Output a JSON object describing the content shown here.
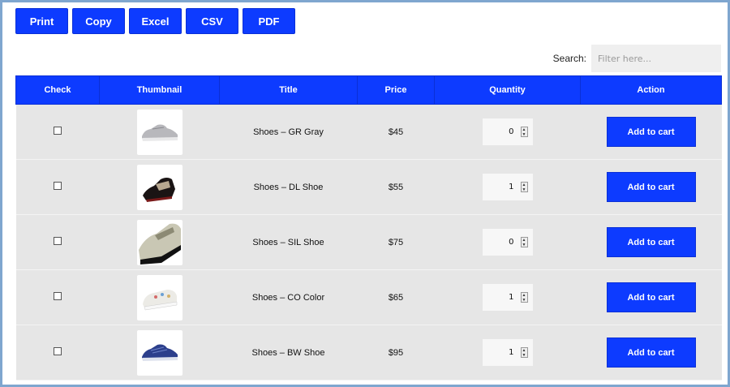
{
  "toolbar": {
    "buttons": [
      {
        "label": "Print"
      },
      {
        "label": "Copy"
      },
      {
        "label": "Excel"
      },
      {
        "label": "CSV"
      },
      {
        "label": "PDF"
      }
    ]
  },
  "search": {
    "label": "Search:",
    "placeholder": "Filter here...",
    "value": ""
  },
  "table": {
    "headers": [
      "Check",
      "Thumbnail",
      "Title",
      "Price",
      "Quantity",
      "Action"
    ],
    "rows": [
      {
        "title": "Shoes – GR Gray",
        "price": "$45",
        "quantity": "0",
        "action": "Add to cart",
        "thumbnail_icon": "gray-sneaker-icon"
      },
      {
        "title": "Shoes – DL Shoe",
        "price": "$55",
        "quantity": "1",
        "action": "Add to cart",
        "thumbnail_icon": "black-dress-shoe-icon"
      },
      {
        "title": "Shoes – SIL Shoe",
        "price": "$75",
        "quantity": "0",
        "action": "Add to cart",
        "thumbnail_icon": "silver-loafer-icon"
      },
      {
        "title": "Shoes – CO Color",
        "price": "$65",
        "quantity": "1",
        "action": "Add to cart",
        "thumbnail_icon": "floral-slip-on-icon"
      },
      {
        "title": "Shoes – BW Shoe",
        "price": "$95",
        "quantity": "1",
        "action": "Add to cart",
        "thumbnail_icon": "blue-sneaker-icon"
      }
    ]
  },
  "colors": {
    "accent": "#0d3bff",
    "row_bg": "#e6e6e6",
    "frame": "#7fa6cf"
  }
}
